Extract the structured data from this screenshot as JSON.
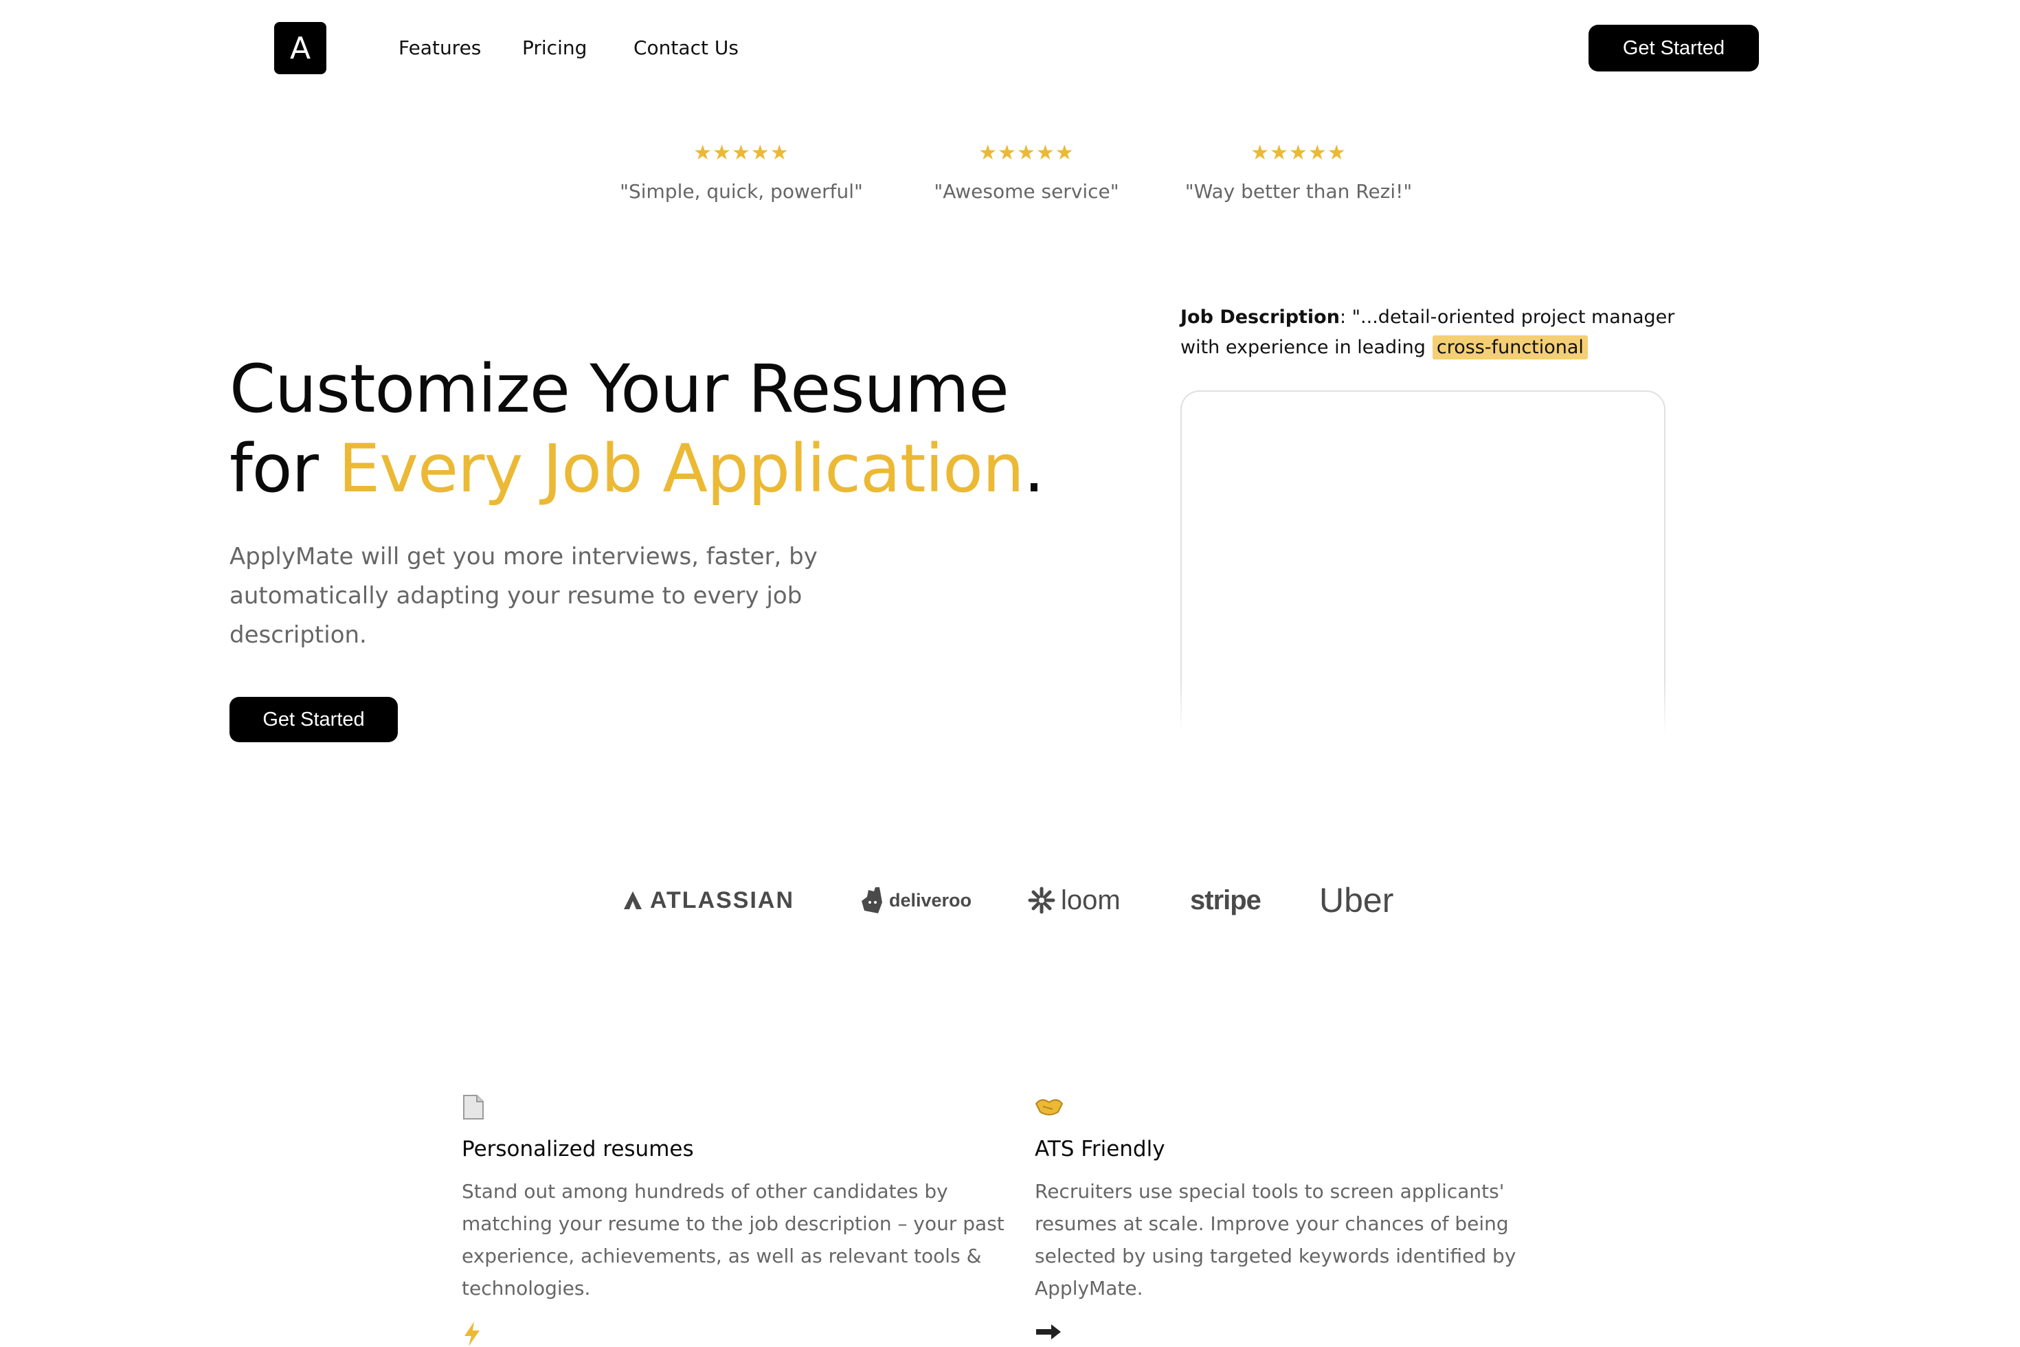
{
  "nav": {
    "logo_letter": "A",
    "links": [
      "Features",
      "Pricing",
      "Contact Us"
    ],
    "cta_label": "Get Started"
  },
  "reviews": [
    {
      "stars": "★★★★★",
      "quote": "\"Simple, quick, powerful\""
    },
    {
      "stars": "★★★★★",
      "quote": "\"Awesome service\""
    },
    {
      "stars": "★★★★★",
      "quote": "\"Way better than Rezi!\""
    }
  ],
  "hero": {
    "title_line1": "Customize Your Resume",
    "title_line2_prefix": "for ",
    "title_line2_accent": "Every Job Application",
    "title_line2_suffix": ".",
    "subtitle": "ApplyMate will get you more interviews, faster, by automatically adapting your resume to every job description.",
    "cta_label": "Get Started"
  },
  "job_description": {
    "label": "Job Description",
    "text": ": \"...detail-oriented project manager with experience in leading",
    "highlight": "cross-functional"
  },
  "brands": [
    "ATLASSIAN",
    "deliveroo",
    "loom",
    "stripe",
    "Uber"
  ],
  "features": [
    {
      "icon": "document-icon",
      "title": "Personalized resumes",
      "description": "Stand out among hundreds of other candidates by matching your resume to the job description – your past experience, achievements, as well as relevant tools & technologies."
    },
    {
      "icon": "handshake-icon",
      "title": "ATS Friendly",
      "description": "Recruiters use special tools to screen applicants' resumes at scale. Improve your chances of being selected by using targeted keywords identified by ApplyMate."
    },
    {
      "icon": "lightning-icon",
      "title": "",
      "description": ""
    },
    {
      "icon": "soon-arrow-icon",
      "title": "",
      "description": ""
    }
  ],
  "colors": {
    "accent": "#ecb935",
    "highlight": "#f5cf74",
    "dark": "#000000",
    "muted": "#666666"
  }
}
